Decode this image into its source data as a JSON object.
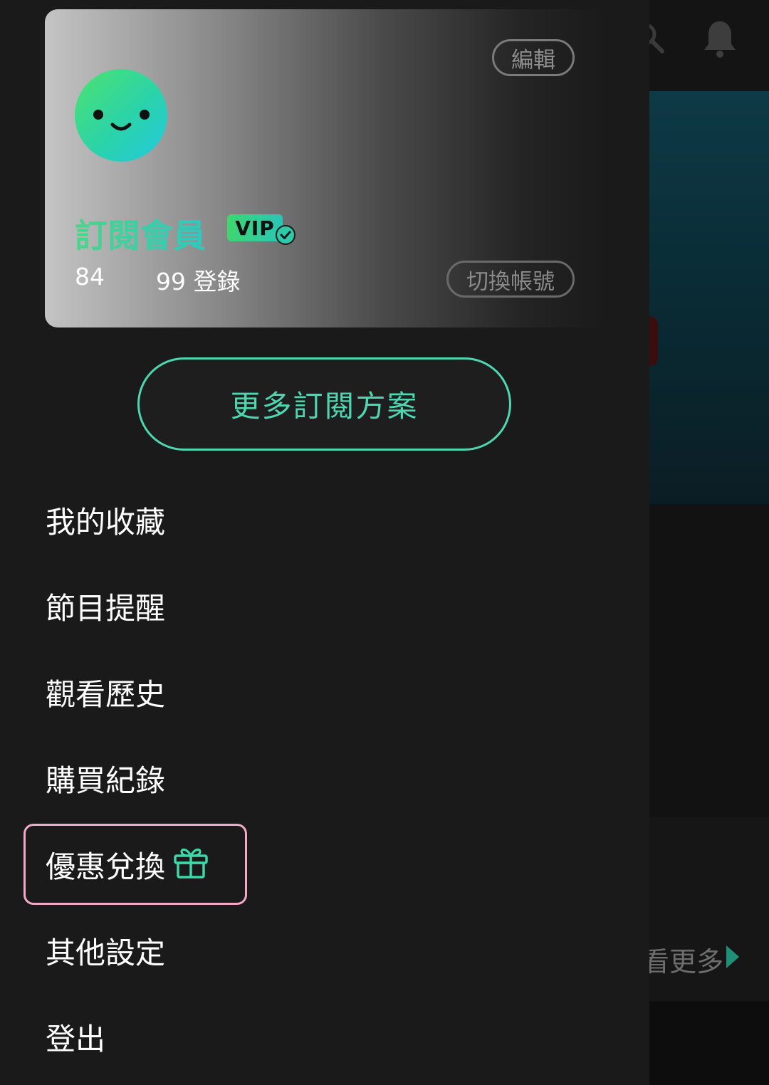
{
  "profile": {
    "edit_label": "編輯",
    "member_title": "訂閱會員",
    "vip_label": "VIP",
    "stat_1": "84",
    "stat_2": "99 登錄",
    "switch_label": "切換帳號",
    "avatar_icon": "smile-face-icon",
    "check_icon": "verified-check-icon"
  },
  "plans_button": "更多訂閱方案",
  "menu": {
    "items": [
      {
        "label": "我的收藏"
      },
      {
        "label": "節目提醒"
      },
      {
        "label": "觀看歷史"
      },
      {
        "label": "購買紀錄"
      },
      {
        "label": "優惠兌換",
        "icon": "gift-icon"
      },
      {
        "label": "其他設定"
      },
      {
        "label": "登出"
      }
    ]
  },
  "background": {
    "see_more": "看更多",
    "icons": [
      "search-icon",
      "bell-icon",
      "play-arrow-icon"
    ]
  },
  "colors": {
    "accent": "#4ed6b0",
    "highlight": "#f2a9c8",
    "drawer_bg": "#1a1a1a"
  }
}
